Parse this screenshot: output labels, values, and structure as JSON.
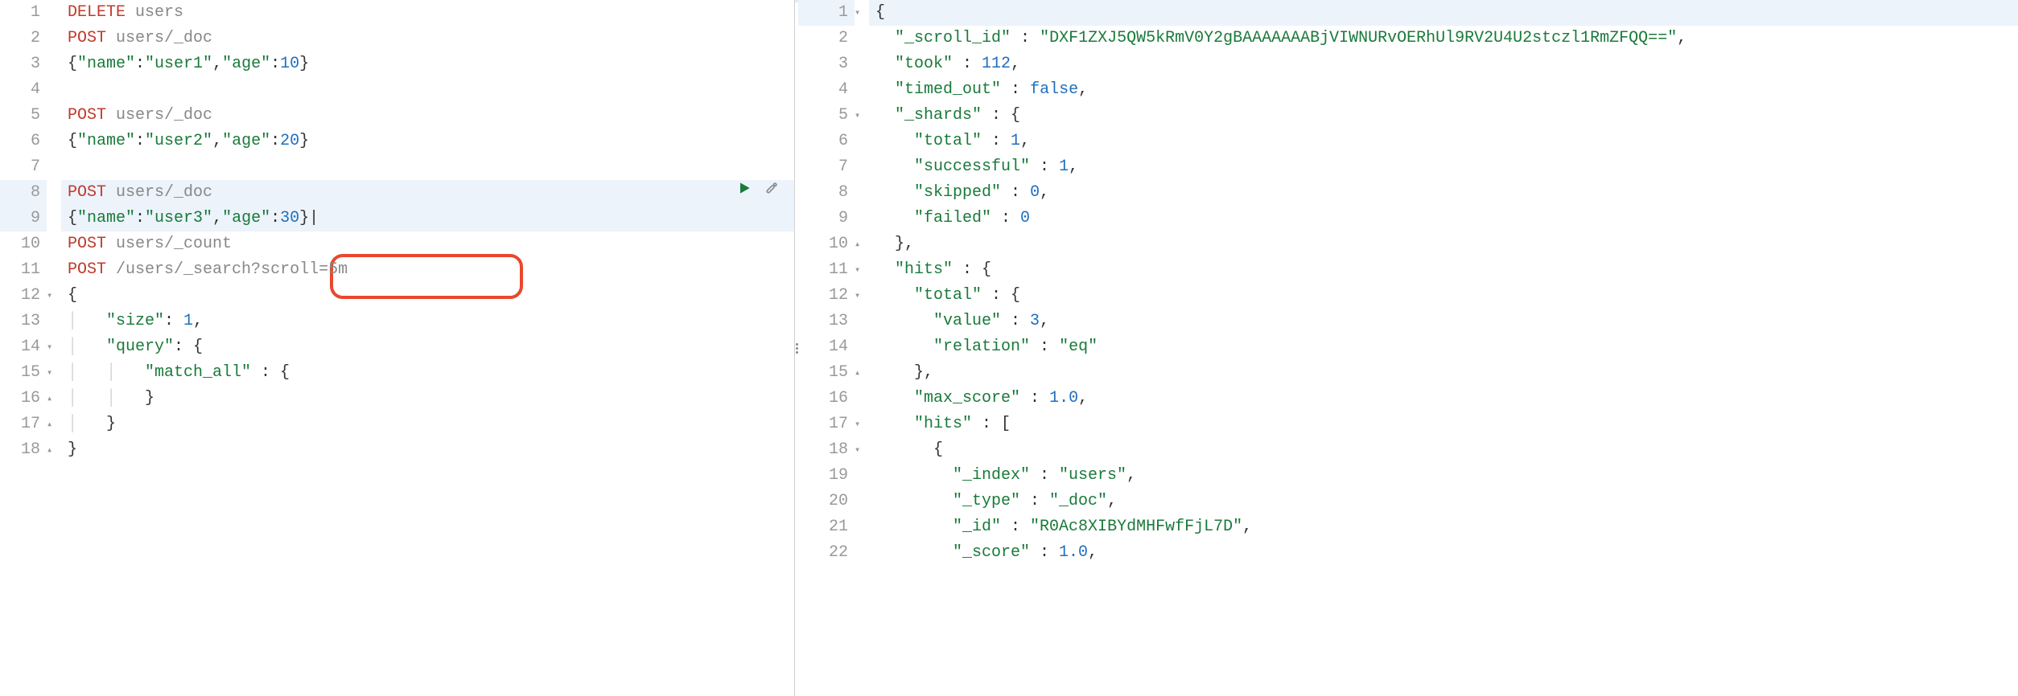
{
  "annotation": {
    "highlight_text": "scroll=5m"
  },
  "left": {
    "lines": [
      {
        "n": 1,
        "fold": "",
        "hl": false,
        "tokens": [
          {
            "c": "kw",
            "t": "DELETE"
          },
          {
            "c": "",
            "t": " "
          },
          {
            "c": "path",
            "t": "users"
          }
        ]
      },
      {
        "n": 2,
        "fold": "",
        "hl": false,
        "tokens": [
          {
            "c": "kw",
            "t": "POST"
          },
          {
            "c": "",
            "t": " "
          },
          {
            "c": "path",
            "t": "users/_doc"
          }
        ]
      },
      {
        "n": 3,
        "fold": "",
        "hl": false,
        "tokens": [
          {
            "c": "pun",
            "t": "{"
          },
          {
            "c": "key",
            "t": "\"name\""
          },
          {
            "c": "pun",
            "t": ":"
          },
          {
            "c": "str",
            "t": "\"user1\""
          },
          {
            "c": "pun",
            "t": ","
          },
          {
            "c": "key",
            "t": "\"age\""
          },
          {
            "c": "pun",
            "t": ":"
          },
          {
            "c": "num",
            "t": "10"
          },
          {
            "c": "pun",
            "t": "}"
          }
        ]
      },
      {
        "n": 4,
        "fold": "",
        "hl": false,
        "tokens": []
      },
      {
        "n": 5,
        "fold": "",
        "hl": false,
        "tokens": [
          {
            "c": "kw",
            "t": "POST"
          },
          {
            "c": "",
            "t": " "
          },
          {
            "c": "path",
            "t": "users/_doc"
          }
        ]
      },
      {
        "n": 6,
        "fold": "",
        "hl": false,
        "tokens": [
          {
            "c": "pun",
            "t": "{"
          },
          {
            "c": "key",
            "t": "\"name\""
          },
          {
            "c": "pun",
            "t": ":"
          },
          {
            "c": "str",
            "t": "\"user2\""
          },
          {
            "c": "pun",
            "t": ","
          },
          {
            "c": "key",
            "t": "\"age\""
          },
          {
            "c": "pun",
            "t": ":"
          },
          {
            "c": "num",
            "t": "20"
          },
          {
            "c": "pun",
            "t": "}"
          }
        ]
      },
      {
        "n": 7,
        "fold": "",
        "hl": false,
        "tokens": []
      },
      {
        "n": 8,
        "fold": "",
        "hl": true,
        "actions": true,
        "tokens": [
          {
            "c": "kw",
            "t": "POST"
          },
          {
            "c": "",
            "t": " "
          },
          {
            "c": "path",
            "t": "users/_doc"
          }
        ]
      },
      {
        "n": 9,
        "fold": "",
        "hl": true,
        "tokens": [
          {
            "c": "pun",
            "t": "{"
          },
          {
            "c": "key",
            "t": "\"name\""
          },
          {
            "c": "pun",
            "t": ":"
          },
          {
            "c": "str",
            "t": "\"user3\""
          },
          {
            "c": "pun",
            "t": ","
          },
          {
            "c": "key",
            "t": "\"age\""
          },
          {
            "c": "pun",
            "t": ":"
          },
          {
            "c": "num",
            "t": "30"
          },
          {
            "c": "pun",
            "t": "}|"
          }
        ]
      },
      {
        "n": 10,
        "fold": "",
        "hl": false,
        "tokens": [
          {
            "c": "kw",
            "t": "POST"
          },
          {
            "c": "",
            "t": " "
          },
          {
            "c": "path",
            "t": "users/_count"
          }
        ]
      },
      {
        "n": 11,
        "fold": "",
        "hl": false,
        "tokens": [
          {
            "c": "kw",
            "t": "POST"
          },
          {
            "c": "",
            "t": " "
          },
          {
            "c": "path",
            "t": "/users/_search?"
          },
          {
            "c": "path",
            "t": "scroll=5m"
          }
        ]
      },
      {
        "n": 12,
        "fold": "▾",
        "hl": false,
        "tokens": [
          {
            "c": "pun",
            "t": "{"
          }
        ]
      },
      {
        "n": 13,
        "fold": "",
        "hl": false,
        "tokens": [
          {
            "c": "indent-guide",
            "t": "│   "
          },
          {
            "c": "key",
            "t": "\"size\""
          },
          {
            "c": "pun",
            "t": ": "
          },
          {
            "c": "num",
            "t": "1"
          },
          {
            "c": "pun",
            "t": ","
          }
        ]
      },
      {
        "n": 14,
        "fold": "▾",
        "hl": false,
        "tokens": [
          {
            "c": "indent-guide",
            "t": "│   "
          },
          {
            "c": "key",
            "t": "\"query\""
          },
          {
            "c": "pun",
            "t": ": {"
          }
        ]
      },
      {
        "n": 15,
        "fold": "▾",
        "hl": false,
        "tokens": [
          {
            "c": "indent-guide",
            "t": "│   │   "
          },
          {
            "c": "key",
            "t": "\"match_all\""
          },
          {
            "c": "pun",
            "t": " : {"
          }
        ]
      },
      {
        "n": 16,
        "fold": "▴",
        "hl": false,
        "tokens": [
          {
            "c": "indent-guide",
            "t": "│   │   "
          },
          {
            "c": "pun",
            "t": "}"
          }
        ]
      },
      {
        "n": 17,
        "fold": "▴",
        "hl": false,
        "tokens": [
          {
            "c": "indent-guide",
            "t": "│   "
          },
          {
            "c": "pun",
            "t": "}"
          }
        ]
      },
      {
        "n": 18,
        "fold": "▴",
        "hl": false,
        "tokens": [
          {
            "c": "pun",
            "t": "}"
          }
        ]
      }
    ]
  },
  "right": {
    "lines": [
      {
        "n": 1,
        "fold": "▾",
        "hl": true,
        "tokens": [
          {
            "c": "pun",
            "t": "{"
          }
        ]
      },
      {
        "n": 2,
        "fold": "",
        "hl": false,
        "tokens": [
          {
            "c": "indent-guide",
            "t": "  "
          },
          {
            "c": "key",
            "t": "\"_scroll_id\""
          },
          {
            "c": "pun",
            "t": " : "
          },
          {
            "c": "str",
            "t": "\"DXF1ZXJ5QW5kRmV0Y2gBAAAAAAABjVIWNURvOERhUl9RV2U4U2stczl1RmZFQQ==\""
          },
          {
            "c": "pun",
            "t": ","
          }
        ]
      },
      {
        "n": 3,
        "fold": "",
        "hl": false,
        "tokens": [
          {
            "c": "indent-guide",
            "t": "  "
          },
          {
            "c": "key",
            "t": "\"took\""
          },
          {
            "c": "pun",
            "t": " : "
          },
          {
            "c": "num",
            "t": "112"
          },
          {
            "c": "pun",
            "t": ","
          }
        ]
      },
      {
        "n": 4,
        "fold": "",
        "hl": false,
        "tokens": [
          {
            "c": "indent-guide",
            "t": "  "
          },
          {
            "c": "key",
            "t": "\"timed_out\""
          },
          {
            "c": "pun",
            "t": " : "
          },
          {
            "c": "bool",
            "t": "false"
          },
          {
            "c": "pun",
            "t": ","
          }
        ]
      },
      {
        "n": 5,
        "fold": "▾",
        "hl": false,
        "tokens": [
          {
            "c": "indent-guide",
            "t": "  "
          },
          {
            "c": "key",
            "t": "\"_shards\""
          },
          {
            "c": "pun",
            "t": " : {"
          }
        ]
      },
      {
        "n": 6,
        "fold": "",
        "hl": false,
        "tokens": [
          {
            "c": "indent-guide",
            "t": "    "
          },
          {
            "c": "key",
            "t": "\"total\""
          },
          {
            "c": "pun",
            "t": " : "
          },
          {
            "c": "num",
            "t": "1"
          },
          {
            "c": "pun",
            "t": ","
          }
        ]
      },
      {
        "n": 7,
        "fold": "",
        "hl": false,
        "tokens": [
          {
            "c": "indent-guide",
            "t": "    "
          },
          {
            "c": "key",
            "t": "\"successful\""
          },
          {
            "c": "pun",
            "t": " : "
          },
          {
            "c": "num",
            "t": "1"
          },
          {
            "c": "pun",
            "t": ","
          }
        ]
      },
      {
        "n": 8,
        "fold": "",
        "hl": false,
        "tokens": [
          {
            "c": "indent-guide",
            "t": "    "
          },
          {
            "c": "key",
            "t": "\"skipped\""
          },
          {
            "c": "pun",
            "t": " : "
          },
          {
            "c": "num",
            "t": "0"
          },
          {
            "c": "pun",
            "t": ","
          }
        ]
      },
      {
        "n": 9,
        "fold": "",
        "hl": false,
        "tokens": [
          {
            "c": "indent-guide",
            "t": "    "
          },
          {
            "c": "key",
            "t": "\"failed\""
          },
          {
            "c": "pun",
            "t": " : "
          },
          {
            "c": "num",
            "t": "0"
          }
        ]
      },
      {
        "n": 10,
        "fold": "▴",
        "hl": false,
        "tokens": [
          {
            "c": "indent-guide",
            "t": "  "
          },
          {
            "c": "pun",
            "t": "},"
          }
        ]
      },
      {
        "n": 11,
        "fold": "▾",
        "hl": false,
        "tokens": [
          {
            "c": "indent-guide",
            "t": "  "
          },
          {
            "c": "key",
            "t": "\"hits\""
          },
          {
            "c": "pun",
            "t": " : {"
          }
        ]
      },
      {
        "n": 12,
        "fold": "▾",
        "hl": false,
        "tokens": [
          {
            "c": "indent-guide",
            "t": "    "
          },
          {
            "c": "key",
            "t": "\"total\""
          },
          {
            "c": "pun",
            "t": " : {"
          }
        ]
      },
      {
        "n": 13,
        "fold": "",
        "hl": false,
        "tokens": [
          {
            "c": "indent-guide",
            "t": "      "
          },
          {
            "c": "key",
            "t": "\"value\""
          },
          {
            "c": "pun",
            "t": " : "
          },
          {
            "c": "num",
            "t": "3"
          },
          {
            "c": "pun",
            "t": ","
          }
        ]
      },
      {
        "n": 14,
        "fold": "",
        "hl": false,
        "tokens": [
          {
            "c": "indent-guide",
            "t": "      "
          },
          {
            "c": "key",
            "t": "\"relation\""
          },
          {
            "c": "pun",
            "t": " : "
          },
          {
            "c": "str",
            "t": "\"eq\""
          }
        ]
      },
      {
        "n": 15,
        "fold": "▴",
        "hl": false,
        "tokens": [
          {
            "c": "indent-guide",
            "t": "    "
          },
          {
            "c": "pun",
            "t": "},"
          }
        ]
      },
      {
        "n": 16,
        "fold": "",
        "hl": false,
        "tokens": [
          {
            "c": "indent-guide",
            "t": "    "
          },
          {
            "c": "key",
            "t": "\"max_score\""
          },
          {
            "c": "pun",
            "t": " : "
          },
          {
            "c": "num",
            "t": "1.0"
          },
          {
            "c": "pun",
            "t": ","
          }
        ]
      },
      {
        "n": 17,
        "fold": "▾",
        "hl": false,
        "tokens": [
          {
            "c": "indent-guide",
            "t": "    "
          },
          {
            "c": "key",
            "t": "\"hits\""
          },
          {
            "c": "pun",
            "t": " : ["
          }
        ]
      },
      {
        "n": 18,
        "fold": "▾",
        "hl": false,
        "tokens": [
          {
            "c": "indent-guide",
            "t": "      "
          },
          {
            "c": "pun",
            "t": "{"
          }
        ]
      },
      {
        "n": 19,
        "fold": "",
        "hl": false,
        "tokens": [
          {
            "c": "indent-guide",
            "t": "        "
          },
          {
            "c": "key",
            "t": "\"_index\""
          },
          {
            "c": "pun",
            "t": " : "
          },
          {
            "c": "str",
            "t": "\"users\""
          },
          {
            "c": "pun",
            "t": ","
          }
        ]
      },
      {
        "n": 20,
        "fold": "",
        "hl": false,
        "tokens": [
          {
            "c": "indent-guide",
            "t": "        "
          },
          {
            "c": "key",
            "t": "\"_type\""
          },
          {
            "c": "pun",
            "t": " : "
          },
          {
            "c": "str",
            "t": "\"_doc\""
          },
          {
            "c": "pun",
            "t": ","
          }
        ]
      },
      {
        "n": 21,
        "fold": "",
        "hl": false,
        "tokens": [
          {
            "c": "indent-guide",
            "t": "        "
          },
          {
            "c": "key",
            "t": "\"_id\""
          },
          {
            "c": "pun",
            "t": " : "
          },
          {
            "c": "str",
            "t": "\"R0Ac8XIBYdMHFwfFjL7D\""
          },
          {
            "c": "pun",
            "t": ","
          }
        ]
      },
      {
        "n": 22,
        "fold": "",
        "hl": false,
        "tokens": [
          {
            "c": "indent-guide",
            "t": "        "
          },
          {
            "c": "key",
            "t": "\"_score\""
          },
          {
            "c": "pun",
            "t": " : "
          },
          {
            "c": "num",
            "t": "1.0"
          },
          {
            "c": "pun",
            "t": ","
          }
        ]
      }
    ]
  }
}
